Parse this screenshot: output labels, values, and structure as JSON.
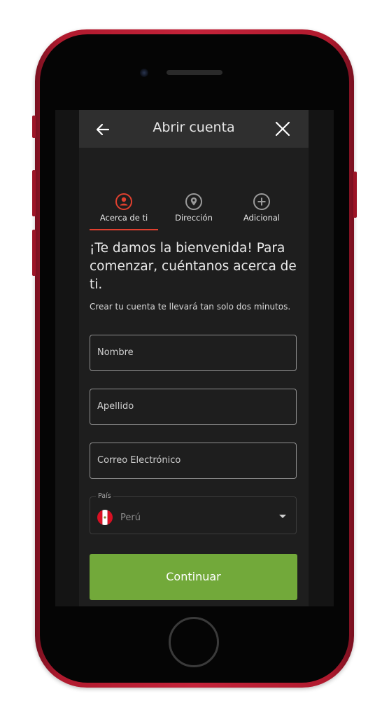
{
  "header": {
    "title": "Abrir cuenta"
  },
  "steps": [
    {
      "label": "Acerca de ti",
      "icon": "user-icon",
      "active": true
    },
    {
      "label": "Dirección",
      "icon": "location-pin-icon",
      "active": false
    },
    {
      "label": "Adicional",
      "icon": "plus-circle-icon",
      "active": false
    }
  ],
  "welcome": {
    "heading": "¡Te damos la bienvenida! Para comenzar, cuéntanos acerca de ti.",
    "subtext": "Crear tu cuenta te llevará tan solo dos minutos."
  },
  "form": {
    "first_name_placeholder": "Nombre",
    "last_name_placeholder": "Apellido",
    "email_placeholder": "Correo Electrónico",
    "country_label": "País",
    "country_value": "Perú"
  },
  "actions": {
    "continue_label": "Continuar"
  },
  "colors": {
    "accent": "#e0402f",
    "primary_button": "#72a93a",
    "phone_frame": "#c4233a"
  }
}
